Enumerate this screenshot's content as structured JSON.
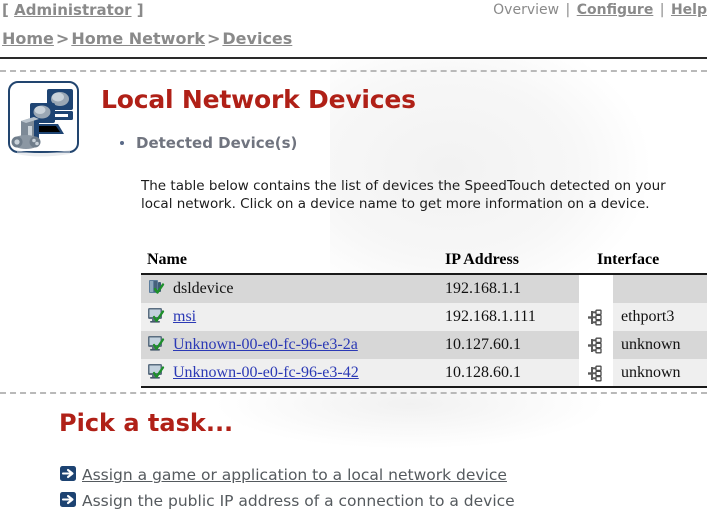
{
  "header": {
    "user_open_bracket": "[",
    "user_label": "Administrator",
    "user_close_bracket": "]",
    "nav": [
      {
        "label": "Overview",
        "active": true
      },
      {
        "label": "Configure",
        "active": false
      },
      {
        "label": "Help",
        "active": false
      }
    ],
    "nav_separator": "|"
  },
  "breadcrumb": {
    "separator": ">",
    "items": [
      {
        "label": "Home"
      },
      {
        "label": "Home Network"
      },
      {
        "label": "Devices"
      }
    ]
  },
  "page": {
    "icon_name": "local-network-devices-icon",
    "title": "Local Network Devices",
    "subheading": "Detected Device(s)",
    "description": "The table below contains the list of devices the SpeedTouch detected on your local network. Click on a device name to get more information on a device."
  },
  "table": {
    "columns": [
      "Name",
      "IP Address",
      "Interface"
    ],
    "rows": [
      {
        "name": "dsldevice",
        "is_link": false,
        "icon": "router-device-icon",
        "ip": "192.168.1.1",
        "interface": "",
        "interface_icon": ""
      },
      {
        "name": "msi",
        "is_link": true,
        "icon": "computer-device-icon",
        "ip": "192.168.1.111",
        "interface": "ethport3",
        "interface_icon": "network-interface-icon"
      },
      {
        "name": "Unknown-00-e0-fc-96-e3-2a",
        "is_link": true,
        "icon": "computer-device-icon",
        "ip": "10.127.60.1",
        "interface": "unknown",
        "interface_icon": "network-interface-icon"
      },
      {
        "name": "Unknown-00-e0-fc-96-e3-42",
        "is_link": true,
        "icon": "computer-device-icon",
        "ip": "10.128.60.1",
        "interface": "unknown",
        "interface_icon": "network-interface-icon"
      }
    ]
  },
  "tasks": {
    "title": "Pick a task...",
    "items": [
      {
        "label": "Assign a game or application to a local network device",
        "icon": "arrow-right-icon",
        "hovered": true
      },
      {
        "label": "Assign the public IP address of a connection to a device",
        "icon": "arrow-right-icon",
        "hovered": false
      }
    ]
  },
  "colors": {
    "title_red": "#b02017",
    "link_blue": "#2b39b5",
    "muted_gray": "#8a8a8a",
    "subhead_gray": "#70747f",
    "row_alt": "#d7d7d7",
    "row_norm": "#efefef",
    "icon_navy": "#1f3f६6"
  }
}
